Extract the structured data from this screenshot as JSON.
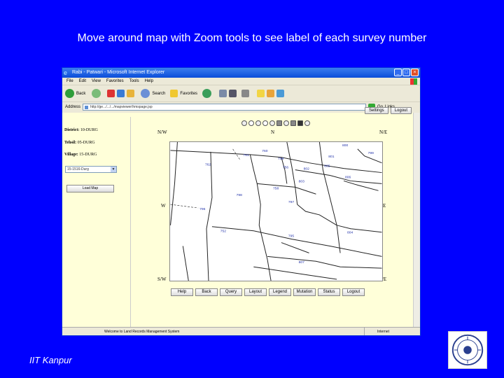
{
  "slide": {
    "title": "Move around map with Zoom tools to see label of each survey number",
    "footer": "IIT Kanpur"
  },
  "browser": {
    "window_title": "Rabi - Patwari - Microsoft Internet Explorer",
    "menu": [
      "File",
      "Edit",
      "View",
      "Favorites",
      "Tools",
      "Help"
    ],
    "toolbar": {
      "back": "Back",
      "search": "Search",
      "favorites": "Favorites"
    },
    "address_label": "Address",
    "address_value": "http://ge.../.../.../mapviewer/hmspage.jsp",
    "go_label": "Go",
    "links_label": "Links",
    "status_text": "Welcome to Land Records Management System",
    "status_zone": "Internet"
  },
  "page": {
    "top_buttons": {
      "settings": "Settings",
      "logout": "Logout"
    },
    "sidebar": {
      "district_label": "District:",
      "district_value": "10-DURG",
      "tehsil_label": "Tehsil:",
      "tehsil_value": "05-DURG",
      "village_label": "Village:",
      "village_value": "15-DURG",
      "village_select_value": "15-1516-Durg",
      "load_map_button": "Load Map"
    },
    "map": {
      "directions": {
        "nw": "N/W",
        "n": "N",
        "ne": "N/E",
        "w": "W",
        "e": "E",
        "sw": "S/W",
        "s": "S",
        "se": "S/E"
      },
      "survey_numbers": [
        "761",
        "760",
        "762",
        "759",
        "756",
        "758",
        "798",
        "797",
        "796",
        "752",
        "795",
        "804",
        "803",
        "802",
        "801",
        "800",
        "799",
        "805",
        "806",
        "807"
      ]
    },
    "map_buttons": [
      "Help",
      "Back",
      "Query",
      "Layout",
      "Legend",
      "Mutation",
      "Status",
      "Logout"
    ]
  },
  "colors": {
    "slide_bg": "#0000ff",
    "page_bg": "#ffffd9",
    "titlebar": "#0a4dd9"
  }
}
